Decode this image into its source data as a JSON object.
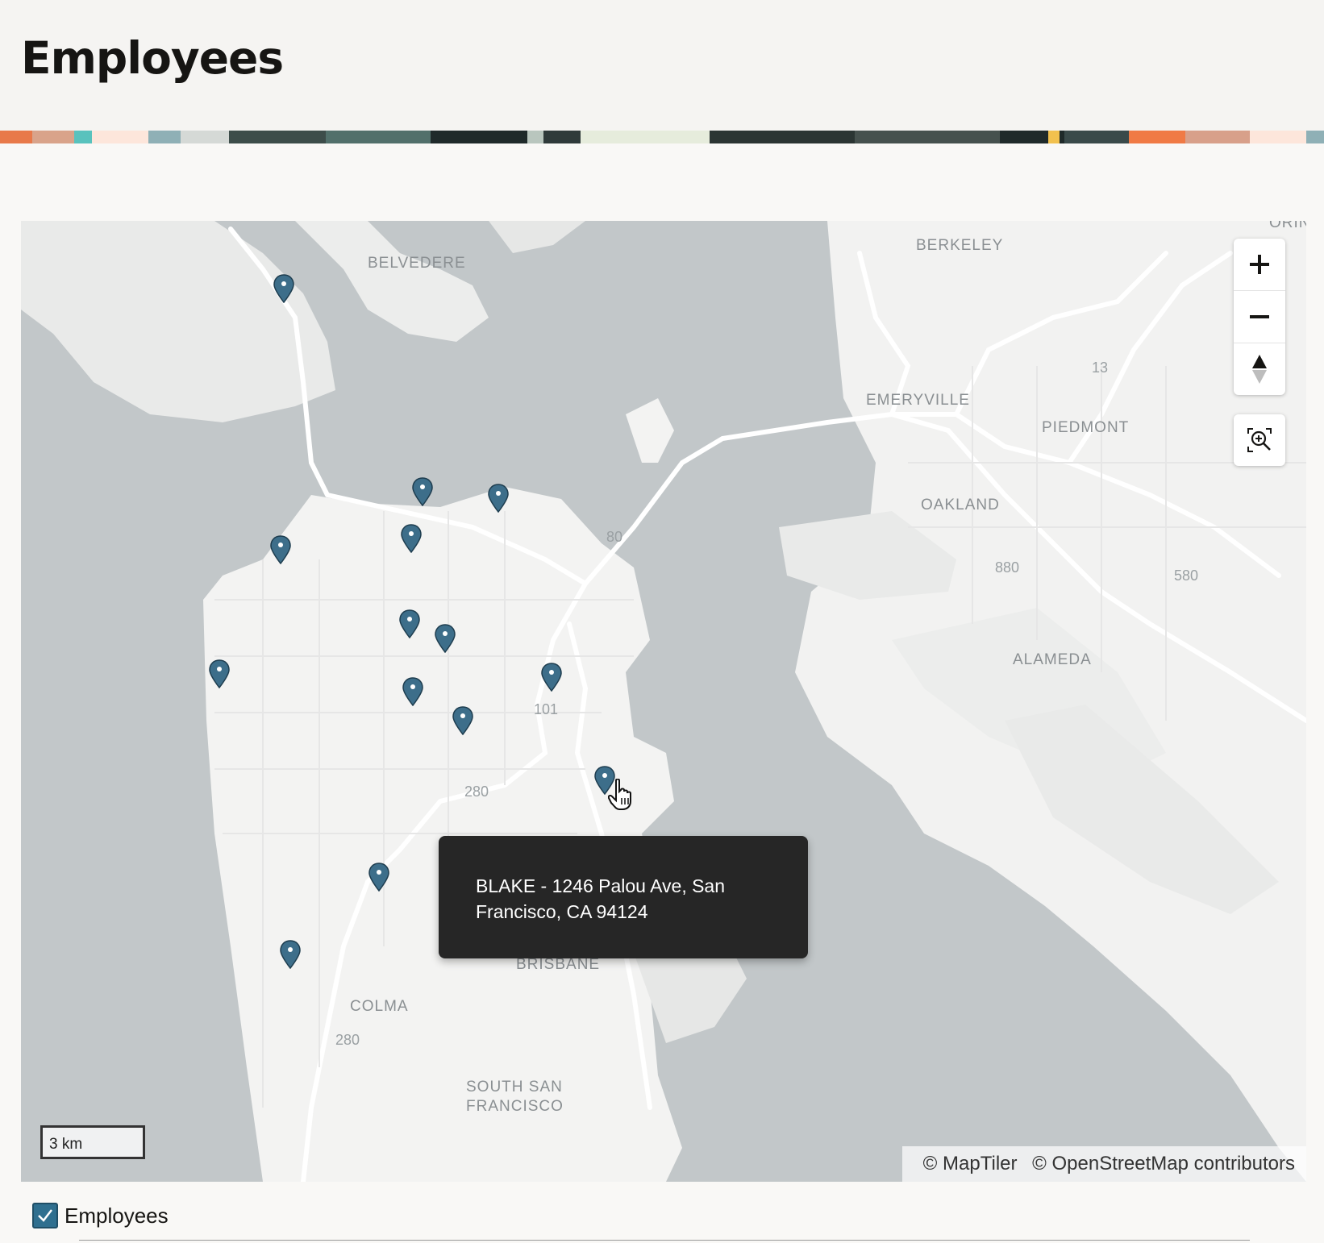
{
  "page": {
    "title": "Employees"
  },
  "map": {
    "places": {
      "belvedere": "BELVEDERE",
      "berkeley": "BERKELEY",
      "emeryville": "EMERYVILLE",
      "piedmont": "PIEDMONT",
      "oakland": "OAKLAND",
      "alameda": "ALAMEDA",
      "brisbane": "BRISBANE",
      "colma": "COLMA",
      "south_sf_1": "SOUTH SAN",
      "south_sf_2": "FRANCISCO",
      "orinda_partial": "ORIN"
    },
    "roads": {
      "r80": "80",
      "r880": "880",
      "r580": "580",
      "r13": "13",
      "r101": "101",
      "r280a": "280",
      "r280b": "280"
    },
    "scale_label": "3 km",
    "attribution": {
      "maptiler": "© MapTiler",
      "osm": "© OpenStreetMap contributors"
    },
    "marker_color": "#3d6e8a",
    "tooltip": {
      "line1": "BLAKE - 1246 Palou Ave, San",
      "line2": "Francisco, CA 94124"
    }
  },
  "controls": {
    "zoom_in_icon": "plus-icon",
    "zoom_out_icon": "minus-icon",
    "compass_icon": "compass-icon",
    "zoom_area_icon": "zoom-area-icon"
  },
  "legend": {
    "label": "Employees",
    "checked": true
  }
}
